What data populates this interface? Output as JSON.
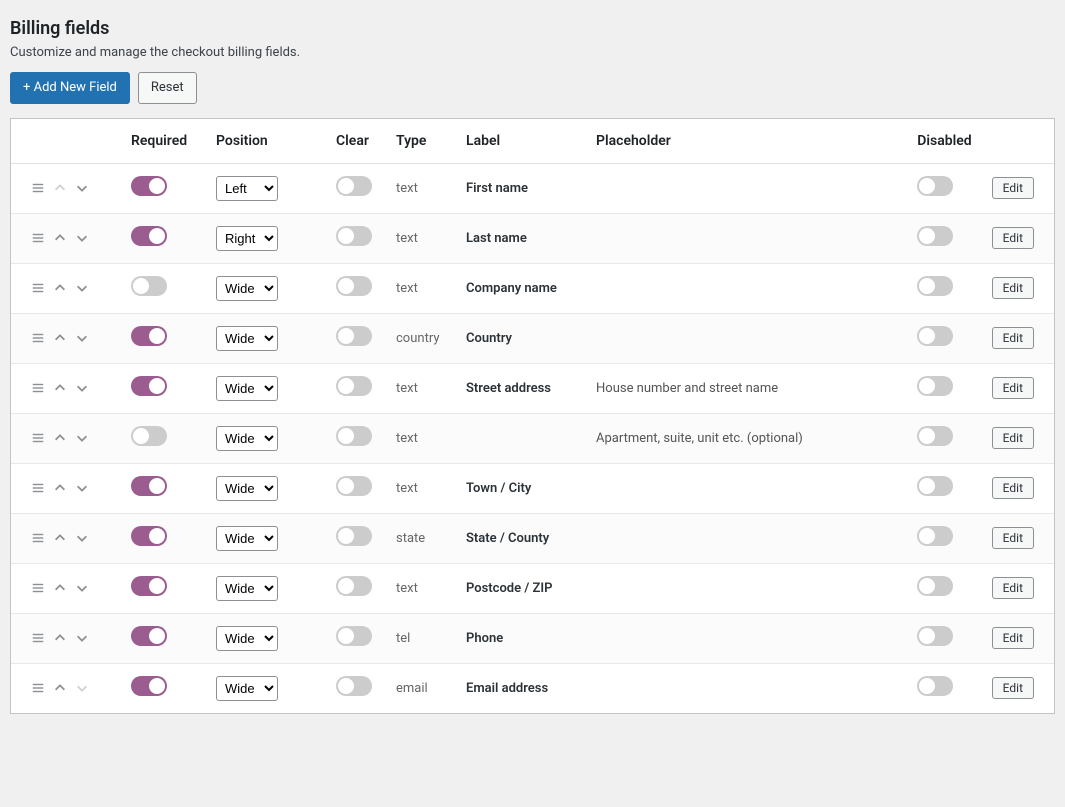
{
  "header": {
    "title": "Billing fields",
    "subtitle": "Customize and manage the checkout billing fields."
  },
  "actions": {
    "add_new_label": "+ Add New Field",
    "reset_label": "Reset",
    "edit_label": "Edit"
  },
  "table": {
    "headers": {
      "required": "Required",
      "position": "Position",
      "clear": "Clear",
      "type": "Type",
      "label": "Label",
      "placeholder": "Placeholder",
      "disabled": "Disabled"
    }
  },
  "position_options": [
    "Left",
    "Right",
    "Wide"
  ],
  "rows": [
    {
      "required": true,
      "position": "Left",
      "clear": false,
      "type": "text",
      "label": "First name",
      "placeholder": "",
      "disabled": false,
      "up_disabled": true,
      "down_disabled": false
    },
    {
      "required": true,
      "position": "Right",
      "clear": false,
      "type": "text",
      "label": "Last name",
      "placeholder": "",
      "disabled": false,
      "up_disabled": false,
      "down_disabled": false
    },
    {
      "required": false,
      "position": "Wide",
      "clear": false,
      "type": "text",
      "label": "Company name",
      "placeholder": "",
      "disabled": false,
      "up_disabled": false,
      "down_disabled": false
    },
    {
      "required": true,
      "position": "Wide",
      "clear": false,
      "type": "country",
      "label": "Country",
      "placeholder": "",
      "disabled": false,
      "up_disabled": false,
      "down_disabled": false
    },
    {
      "required": true,
      "position": "Wide",
      "clear": false,
      "type": "text",
      "label": "Street address",
      "placeholder": "House number and street name",
      "disabled": false,
      "up_disabled": false,
      "down_disabled": false
    },
    {
      "required": false,
      "position": "Wide",
      "clear": false,
      "type": "text",
      "label": "",
      "placeholder": "Apartment, suite, unit etc. (optional)",
      "disabled": false,
      "up_disabled": false,
      "down_disabled": false
    },
    {
      "required": true,
      "position": "Wide",
      "clear": false,
      "type": "text",
      "label": "Town / City",
      "placeholder": "",
      "disabled": false,
      "up_disabled": false,
      "down_disabled": false
    },
    {
      "required": true,
      "position": "Wide",
      "clear": false,
      "type": "state",
      "label": "State / County",
      "placeholder": "",
      "disabled": false,
      "up_disabled": false,
      "down_disabled": false
    },
    {
      "required": true,
      "position": "Wide",
      "clear": false,
      "type": "text",
      "label": "Postcode / ZIP",
      "placeholder": "",
      "disabled": false,
      "up_disabled": false,
      "down_disabled": false
    },
    {
      "required": true,
      "position": "Wide",
      "clear": false,
      "type": "tel",
      "label": "Phone",
      "placeholder": "",
      "disabled": false,
      "up_disabled": false,
      "down_disabled": false
    },
    {
      "required": true,
      "position": "Wide",
      "clear": false,
      "type": "email",
      "label": "Email address",
      "placeholder": "",
      "disabled": false,
      "up_disabled": false,
      "down_disabled": true
    }
  ]
}
